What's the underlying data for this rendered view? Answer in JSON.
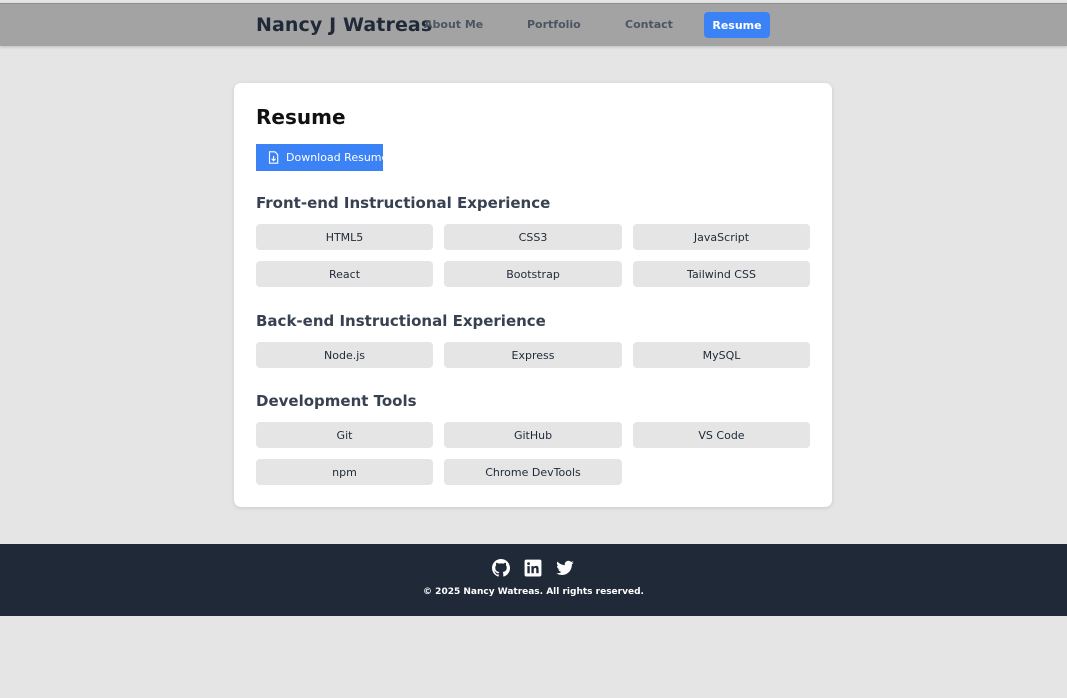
{
  "header": {
    "brand": "Nancy J Watreas",
    "nav": {
      "about": "About Me",
      "portfolio": "Portfolio",
      "contact": "Contact",
      "resume": "Resume"
    }
  },
  "resume": {
    "title": "Resume",
    "download_label": "Download Resume",
    "sections": [
      {
        "title": "Front-end Instructional Experience",
        "skills": [
          "HTML5",
          "CSS3",
          "JavaScript",
          "React",
          "Bootstrap",
          "Tailwind CSS"
        ]
      },
      {
        "title": "Back-end Instructional Experience",
        "skills": [
          "Node.js",
          "Express",
          "MySQL"
        ]
      },
      {
        "title": "Development Tools",
        "skills": [
          "Git",
          "GitHub",
          "VS Code",
          "npm",
          "Chrome DevTools"
        ]
      }
    ]
  },
  "footer": {
    "social_icons": [
      "github-icon",
      "linkedin-icon",
      "twitter-icon"
    ],
    "copyright": "© 2025 Nancy Watreas. All rights reserved."
  },
  "colors": {
    "accent": "#3b82f6",
    "header_bg": "#a3a3a3",
    "page_bg": "#e5e5e5",
    "footer_bg": "#1f2937"
  }
}
